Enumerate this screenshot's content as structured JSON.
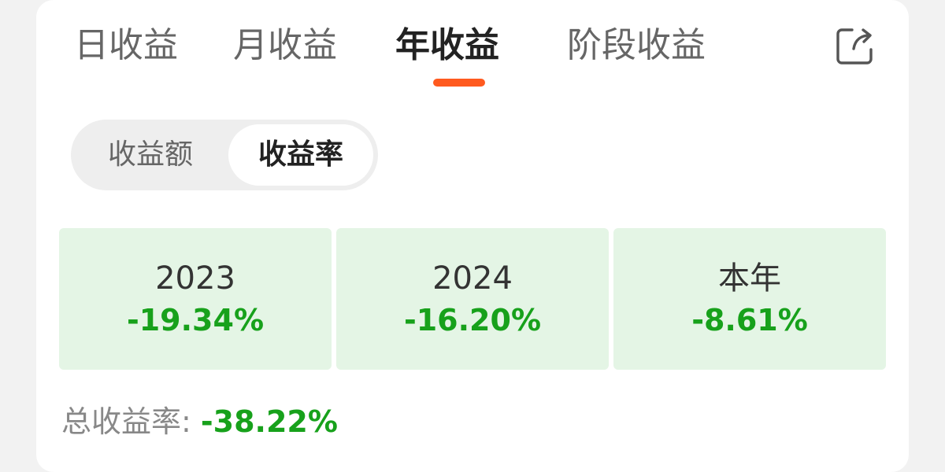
{
  "tabs": [
    {
      "label": "日收益",
      "active": false
    },
    {
      "label": "月收益",
      "active": false
    },
    {
      "label": "年收益",
      "active": true
    },
    {
      "label": "阶段收益",
      "active": false
    }
  ],
  "share_icon": "share-icon",
  "toggle": {
    "options": [
      "收益额",
      "收益率"
    ],
    "selected": "收益率"
  },
  "yearly": [
    {
      "period": "2023",
      "rate": "-19.34%"
    },
    {
      "period": "2024",
      "rate": "-16.20%"
    },
    {
      "period": "本年",
      "rate": "-8.61%"
    }
  ],
  "total": {
    "label": "总收益率:",
    "value": "-38.22%"
  },
  "colors": {
    "accent": "#ff5a1f",
    "negative": "#17a11b",
    "box_background": "#e4f5e5",
    "card_background": "#ffffff"
  }
}
